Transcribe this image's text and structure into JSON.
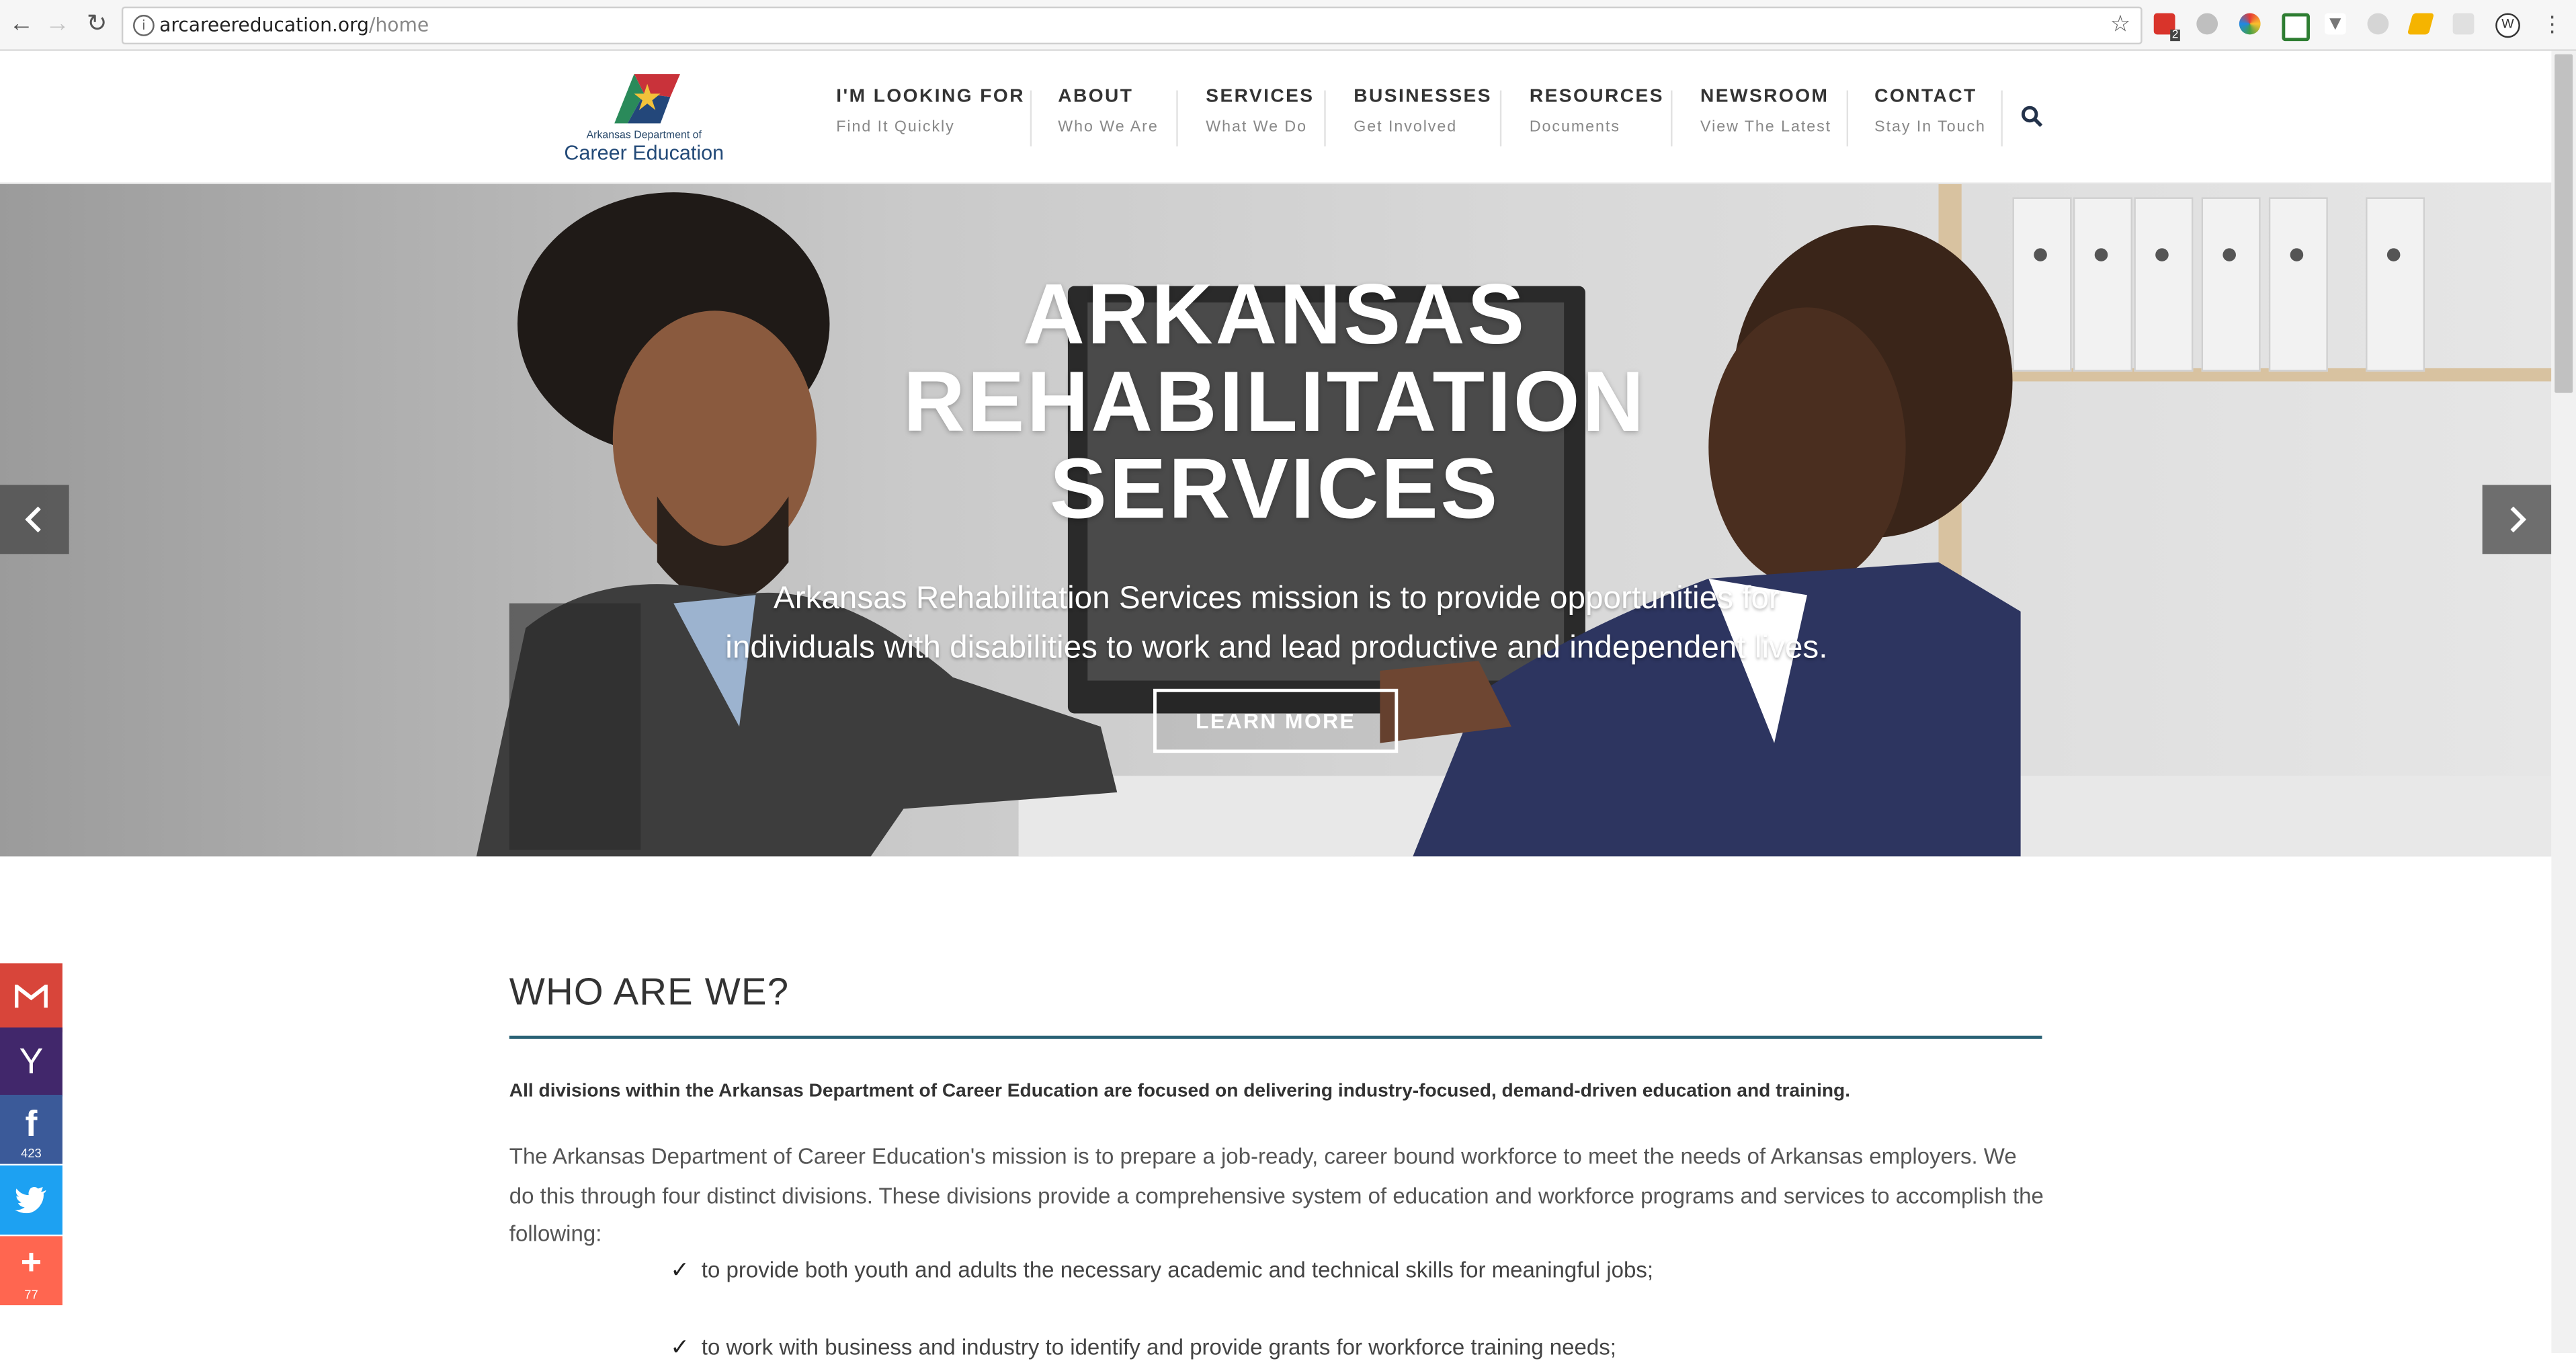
{
  "browser": {
    "url_domain": "arcareereducation.org",
    "url_path": "/home",
    "extension_badge": "2"
  },
  "header": {
    "logo_line1": "Arkansas Department of",
    "logo_line2": "Career Education",
    "menu": [
      {
        "label": "I'M LOOKING FOR",
        "sub": "Find It Quickly"
      },
      {
        "label": "ABOUT",
        "sub": "Who We Are"
      },
      {
        "label": "SERVICES",
        "sub": "What We Do"
      },
      {
        "label": "BUSINESSES",
        "sub": "Get Involved"
      },
      {
        "label": "RESOURCES",
        "sub": "Documents"
      },
      {
        "label": "NEWSROOM",
        "sub": "View The Latest"
      },
      {
        "label": "CONTACT",
        "sub": "Stay In Touch"
      }
    ]
  },
  "hero": {
    "title_line1": "ARKANSAS",
    "title_line2": "REHABILITATION",
    "title_line3": "SERVICES",
    "text_line1": "Arkansas Rehabilitation Services mission is to provide opportunities for",
    "text_line2": "individuals with disabilities to work and lead productive and independent lives.",
    "button": "LEARN MORE"
  },
  "content": {
    "title": "WHO ARE WE?",
    "lead": "All divisions within the Arkansas Department of Career Education are focused on delivering industry-focused, demand-driven education and training.",
    "paragraph": "The Arkansas Department of Career Education's mission is to prepare a job-ready, career bound workforce to meet the needs of Arkansas employers. We do this through four distinct divisions. These divisions provide a comprehensive system of education and workforce programs and services to accomplish the following:",
    "list": [
      "to provide both youth and adults the necessary academic and technical skills for meaningful jobs;",
      "to work with business and industry to identify and provide grants for workforce training needs;"
    ]
  },
  "share": {
    "facebook_count": "423",
    "more_count": "77"
  },
  "colors": {
    "gmail": "#d8453a",
    "yahoo": "#41276b",
    "facebook": "#3b5a99",
    "twitter": "#1da1f2",
    "more": "#ff6650",
    "accent_rule": "#2a6275"
  }
}
